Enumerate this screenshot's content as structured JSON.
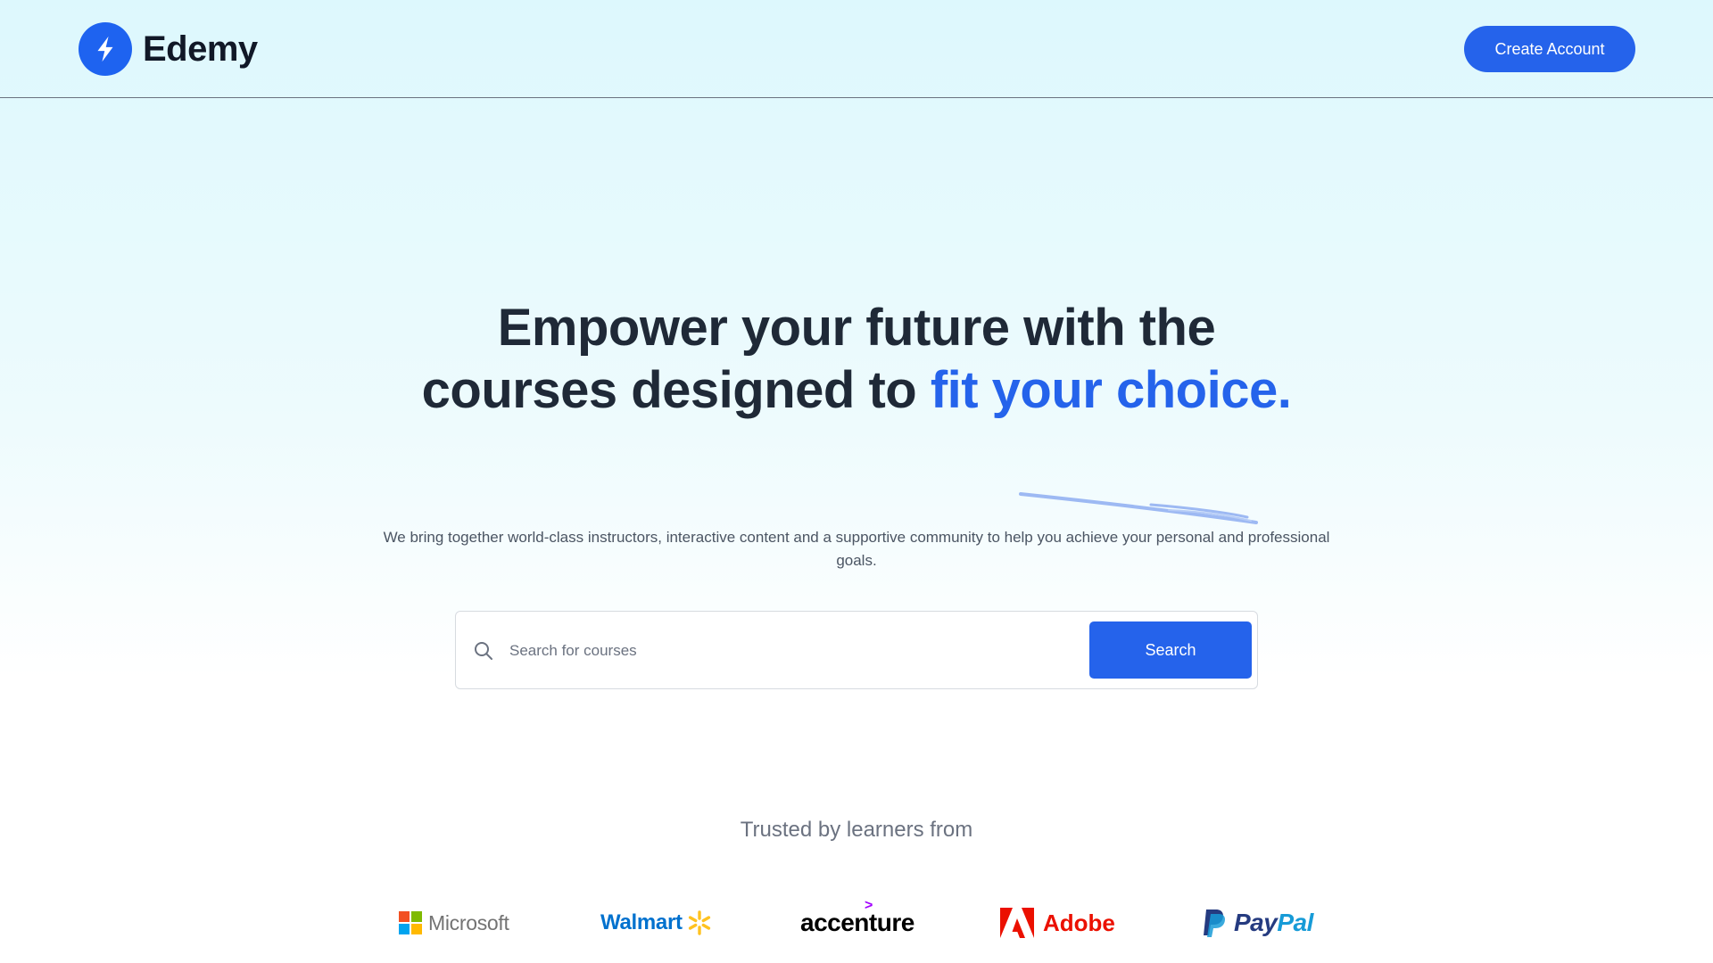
{
  "header": {
    "brand_name": "Edemy",
    "brand_icon": "lightning-bolt-icon",
    "create_account_label": "Create Account"
  },
  "hero": {
    "title_part1": "Empower your future with the courses designed to ",
    "title_accent": "fit your choice.",
    "subtitle": "We bring together world-class instructors, interactive content and a supportive community to help you achieve your personal and professional goals."
  },
  "search": {
    "placeholder": "Search for courses",
    "value": "",
    "button_label": "Search",
    "icon": "search-icon"
  },
  "trusted": {
    "heading": "Trusted by learners from",
    "logos": [
      {
        "name": "Microsoft"
      },
      {
        "name": "Walmart"
      },
      {
        "name": "accenture"
      },
      {
        "name": "Adobe"
      },
      {
        "pay": "Pay",
        "pal": "Pal"
      }
    ]
  },
  "colors": {
    "accent": "#2563eb",
    "title": "#1f2937",
    "background_top": "#ddf8fd",
    "background_bottom": "#ffffff"
  }
}
